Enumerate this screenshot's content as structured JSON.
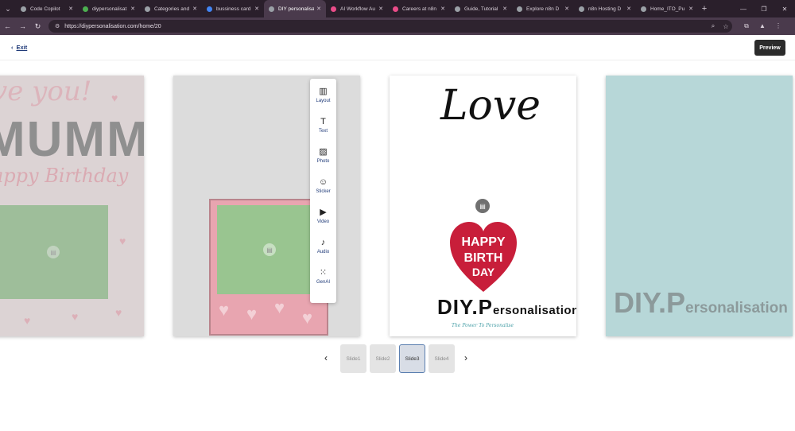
{
  "browser": {
    "tabs": [
      {
        "label": "Code Copilot",
        "color": "#9aa0a6"
      },
      {
        "label": "diypersonalisat",
        "color": "#4caf50"
      },
      {
        "label": "Categories and",
        "color": "#9aa0a6"
      },
      {
        "label": "bussiness card",
        "color": "#4285f4"
      },
      {
        "label": "DIY personalisa",
        "color": "#9aa0a6",
        "active": true
      },
      {
        "label": "AI Workflow Au",
        "color": "#ea4c89"
      },
      {
        "label": "Careers at n8n",
        "color": "#ea4c89"
      },
      {
        "label": "Guide, Tutorial",
        "color": "#9aa0a6"
      },
      {
        "label": "Explore n8n D",
        "color": "#9aa0a6"
      },
      {
        "label": "n8n Hosting D",
        "color": "#9aa0a6"
      },
      {
        "label": "Home_ITO_Pu",
        "color": "#9aa0a6"
      }
    ],
    "close_glyph": "✕",
    "new_tab": "+",
    "url": "https://diypersonalisation.com/home/20"
  },
  "header": {
    "exit_label": "Exit",
    "preview_label": "Preview"
  },
  "toolbar": {
    "items": [
      {
        "label": "Layout",
        "icon": "layout-icon"
      },
      {
        "label": "Text",
        "icon": "text-icon"
      },
      {
        "label": "Photo",
        "icon": "photo-icon"
      },
      {
        "label": "Sticker",
        "icon": "sticker-icon"
      },
      {
        "label": "Video",
        "icon": "video-icon"
      },
      {
        "label": "Audio",
        "icon": "audio-icon"
      },
      {
        "label": "GenAI",
        "icon": "genai-icon"
      }
    ]
  },
  "slides": {
    "s1_line1": "ve you!",
    "s1_line2": "MUMMY",
    "s1_line3": "appy Birthday",
    "s3_love": "Love",
    "s3_heart_words": [
      "HAPPY",
      "BIRTH",
      "DAY"
    ],
    "s3_brand_big": "DIY.P",
    "s3_brand_small": "ersonalisation",
    "s3_tagline": "The Power To Personalise",
    "s4_brand_big": "DIY.P",
    "s4_brand_small": "ersonalisation"
  },
  "pager": {
    "slides": [
      "Slide1",
      "Slide2",
      "Slide3",
      "Slide4"
    ],
    "active": "Slide3",
    "prev": "‹",
    "next": "›"
  }
}
